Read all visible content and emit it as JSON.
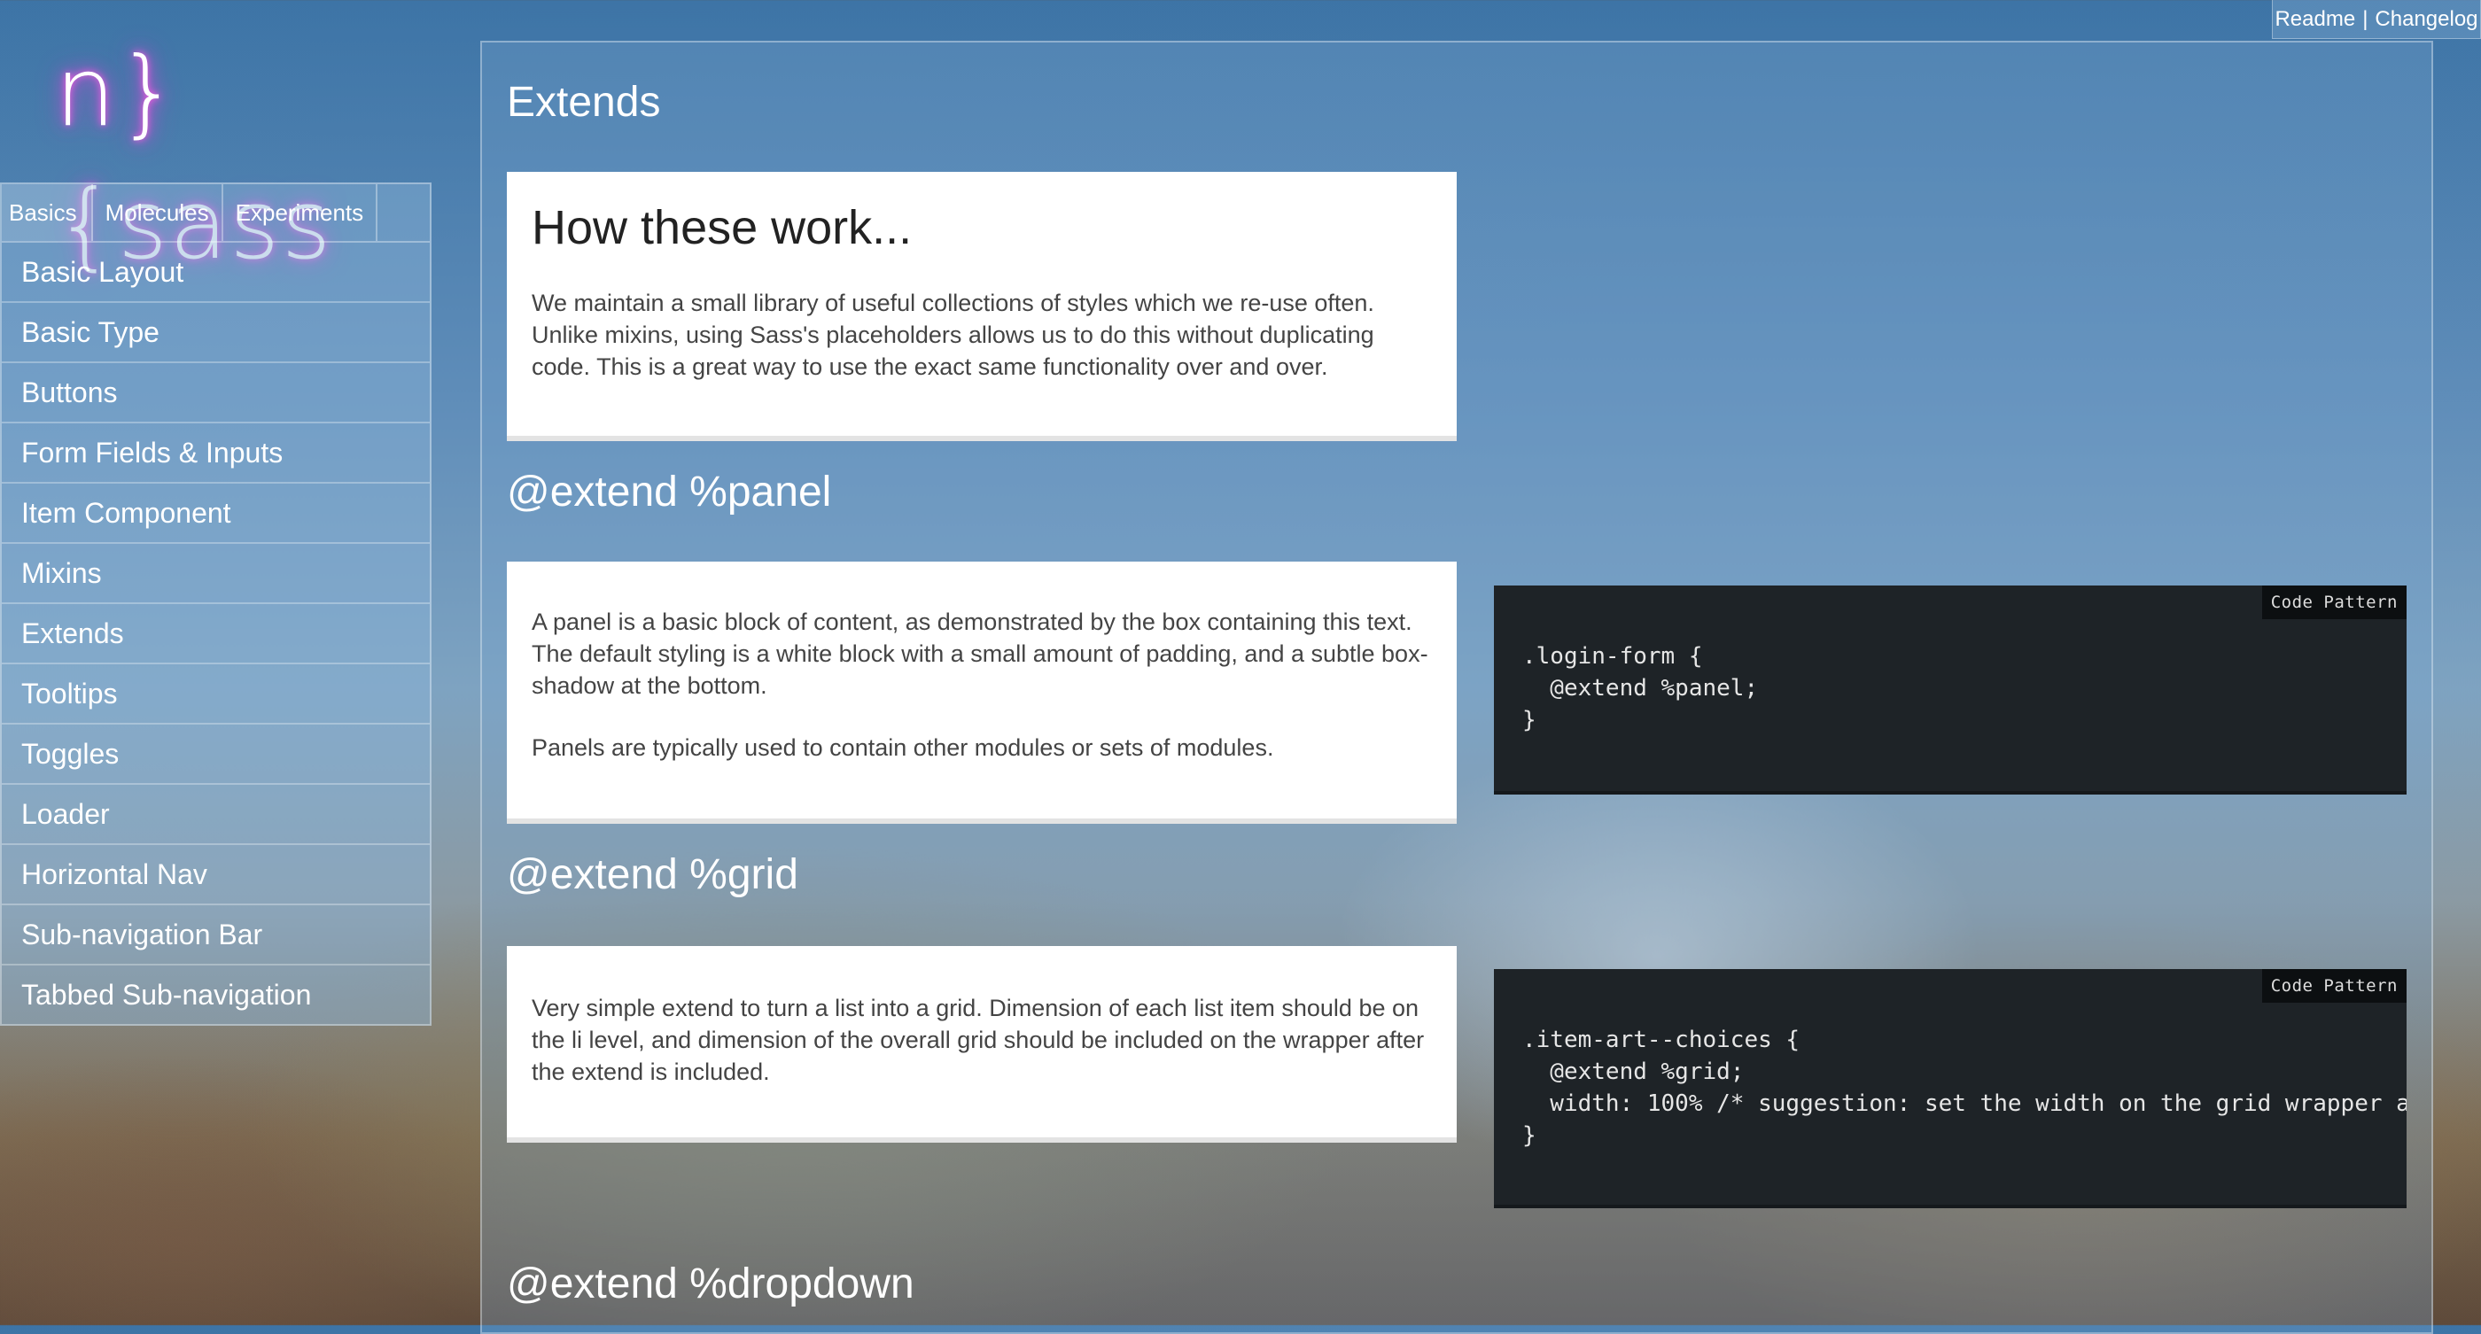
{
  "top_links": {
    "readme": "Readme",
    "separator": "|",
    "changelog": "Changelog"
  },
  "logo": {
    "text": "n}{sass"
  },
  "sidebar": {
    "tabs": [
      "Basics",
      "Molecules",
      "Experiments"
    ],
    "active_tab": "Basics",
    "items": [
      "Basic Layout",
      "Basic Type",
      "Buttons",
      "Form Fields & Inputs",
      "Item Component",
      "Mixins",
      "Extends",
      "Tooltips",
      "Toggles",
      "Loader",
      "Horizontal Nav",
      "Sub-navigation Bar",
      "Tabbed Sub-navigation"
    ]
  },
  "main": {
    "title": "Extends",
    "intro": {
      "heading": "How these work...",
      "text": "We maintain a small library of useful collections of styles which we re-use often. Unlike mixins, using Sass's placeholders allows us to do this without duplicating code. This is a great way to use the exact same functionality over and over."
    },
    "sections": [
      {
        "title": "@extend %panel",
        "paragraphs": [
          "A panel is a basic block of content, as demonstrated by the box containing this text. The default styling is a white block with a small amount of padding, and a subtle box-shadow at the bottom.",
          "Panels are typically used to contain other modules or sets of modules."
        ],
        "code_badge": "Code Pattern",
        "code": ".login-form {\n  @extend %panel;\n}"
      },
      {
        "title": "@extend %grid",
        "paragraphs": [
          "Very simple extend to turn a list into a grid. Dimension of each list item should be on the li level, and dimension of the overall grid should be included on the wrapper after the extend is included."
        ],
        "code_badge": "Code Pattern",
        "code": ".item-art--choices {\n  @extend %grid;\n  width: 100% /* suggestion: set the width on the grid wrapper a\n}"
      },
      {
        "title": "@extend %dropdown"
      }
    ]
  }
}
